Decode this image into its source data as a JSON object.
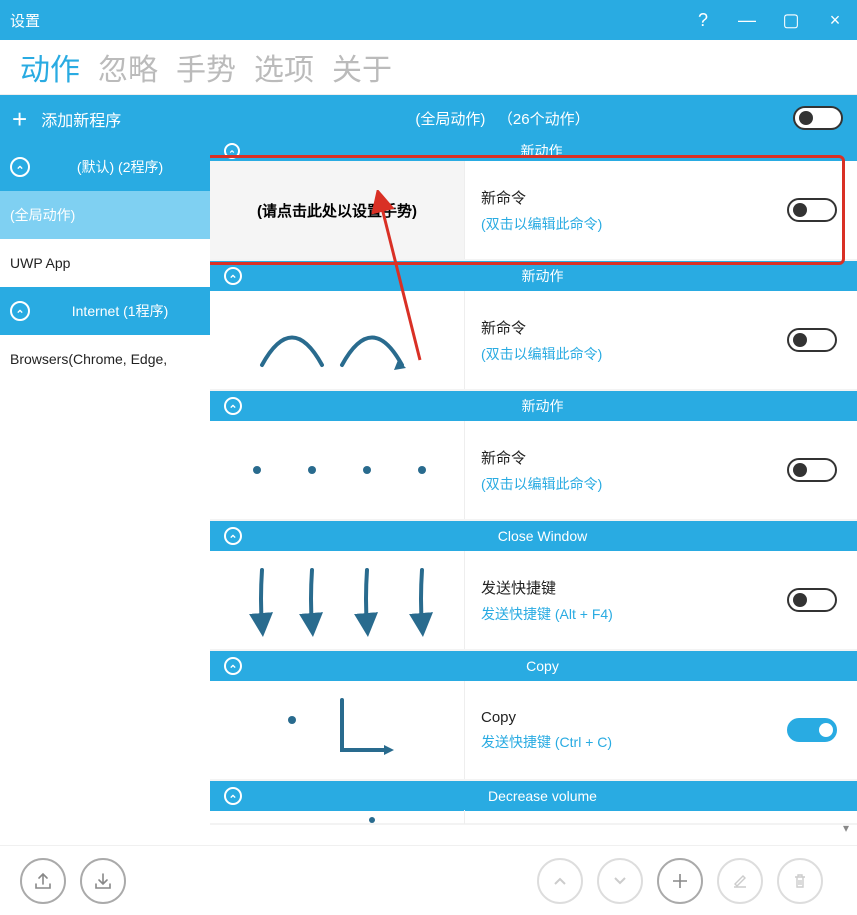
{
  "window": {
    "title": "设置"
  },
  "tabs": [
    "动作",
    "忽略",
    "手势",
    "选项",
    "关于"
  ],
  "active_tab": 0,
  "sidebar": {
    "add_label": "添加新程序",
    "items": [
      {
        "label": "(默认) (2程序)",
        "style": "blue",
        "chev": true
      },
      {
        "label": "(全局动作)",
        "style": "lightblue",
        "chev": false
      },
      {
        "label": "UWP App",
        "style": "white",
        "chev": false
      },
      {
        "label": "Internet (1程序)",
        "style": "blue",
        "chev": true
      },
      {
        "label": "Browsers(Chrome, Edge,",
        "style": "white",
        "chev": false
      }
    ]
  },
  "header": {
    "scope": "(全局动作)",
    "count": "（26个动作）",
    "toggle_on": false
  },
  "sections": [
    {
      "title": "新动作",
      "card": {
        "gesture_placeholder": "(请点击此处以设置手势)",
        "gesture_kind": "placeholder",
        "name": "新命令",
        "sub": "(双击以编辑此命令)",
        "toggle_on": false,
        "highlighted": true
      }
    },
    {
      "title": "新动作",
      "card": {
        "gesture_kind": "double-arch",
        "name": "新命令",
        "sub": "(双击以编辑此命令)",
        "toggle_on": false
      }
    },
    {
      "title": "新动作",
      "card": {
        "gesture_kind": "dots4",
        "name": "新命令",
        "sub": "(双击以编辑此命令)",
        "toggle_on": false
      }
    },
    {
      "title": "Close Window",
      "card": {
        "gesture_kind": "four-down",
        "name": "发送快捷键",
        "sub": "发送快捷键 (Alt + F4)",
        "toggle_on": false
      }
    },
    {
      "title": "Copy",
      "card": {
        "gesture_kind": "dot-L",
        "name": "Copy",
        "sub": "发送快捷键 (Ctrl + C)",
        "toggle_on": true
      }
    },
    {
      "title": "Decrease volume",
      "card": {
        "gesture_kind": "partial",
        "name": "",
        "sub": "",
        "toggle_on": false
      }
    }
  ],
  "footer_buttons": {
    "export": "export-icon",
    "import": "import-icon",
    "up": "up-icon",
    "down": "down-icon",
    "add": "add-icon",
    "edit": "edit-icon",
    "delete": "delete-icon"
  }
}
